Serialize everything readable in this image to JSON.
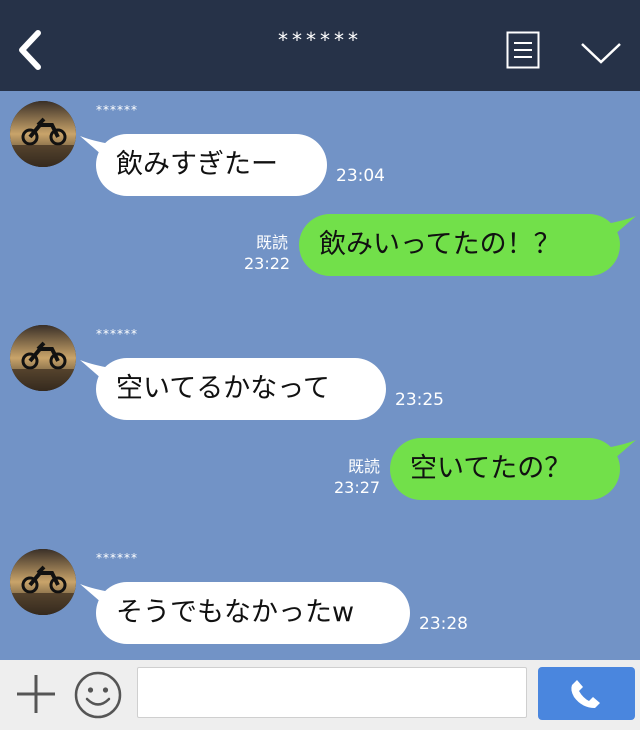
{
  "header": {
    "title": "******"
  },
  "messages": [
    {
      "side": "in",
      "sender": "******",
      "text": "飲みすぎたー",
      "time": "23:04"
    },
    {
      "side": "out",
      "read": "既読",
      "text": "飲みいってたの！？",
      "time": "23:22"
    },
    {
      "side": "in",
      "sender": "******",
      "text": "空いてるかなって",
      "time": "23:25"
    },
    {
      "side": "out",
      "read": "既読",
      "text": "空いてたの？",
      "time": "23:27"
    },
    {
      "side": "in",
      "sender": "******",
      "text": "そうでもなかったw",
      "time": "23:28"
    }
  ],
  "colors": {
    "header_bg": "#263248",
    "chat_bg": "#7293c6",
    "incoming_bubble": "#ffffff",
    "outgoing_bubble": "#72e04a",
    "call_button": "#4a86de"
  },
  "icons": [
    "back-arrow-icon",
    "notes-icon",
    "chevron-down-icon",
    "plus-icon",
    "smiley-icon",
    "phone-icon"
  ]
}
